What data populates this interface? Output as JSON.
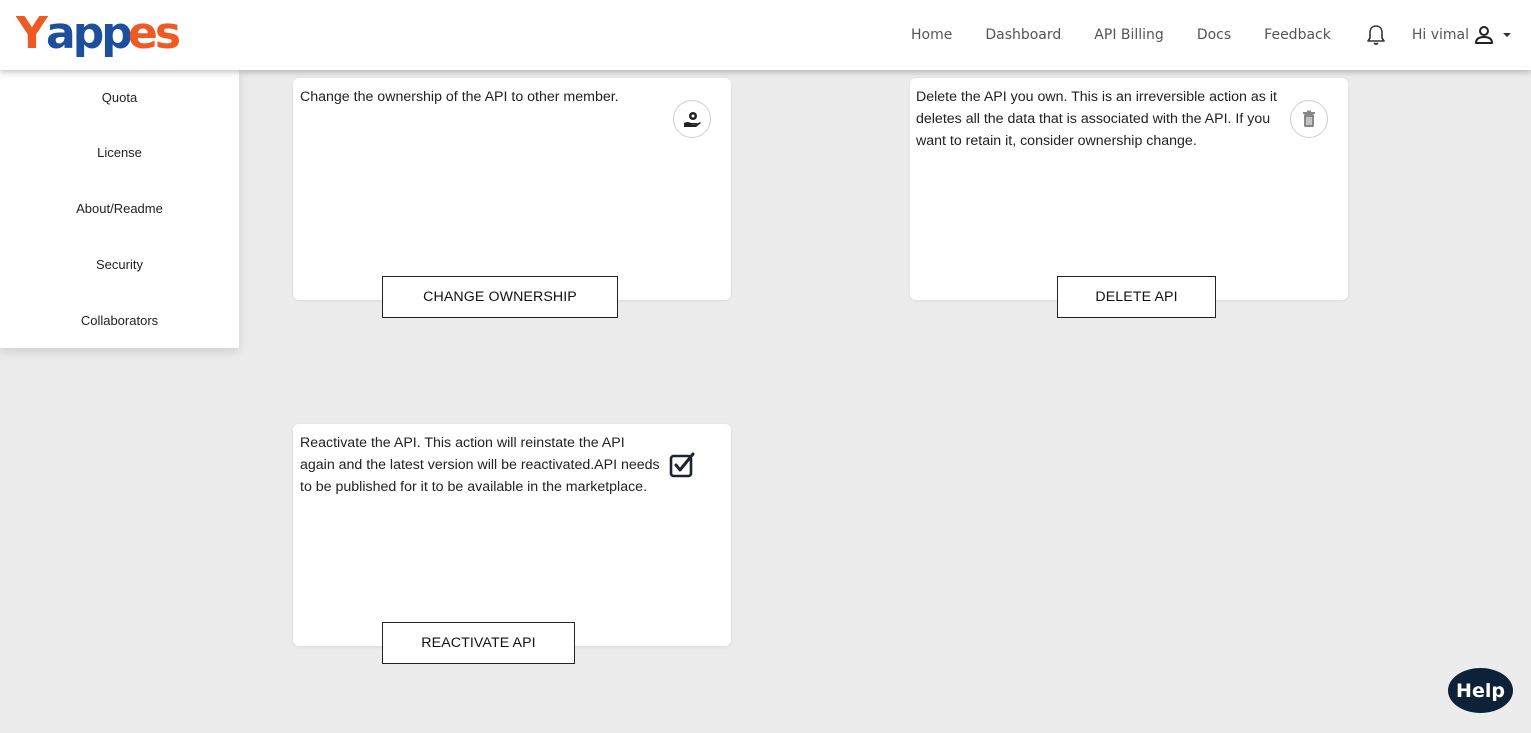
{
  "app": {
    "logo_text": "Yappes"
  },
  "nav": {
    "links": [
      "Home",
      "Dashboard",
      "API Billing",
      "Docs",
      "Feedback"
    ],
    "greeting": "Hi vimal"
  },
  "sidebar": {
    "items": [
      {
        "label": "Quota"
      },
      {
        "label": "License"
      },
      {
        "label": "About/Readme"
      },
      {
        "label": "Security"
      },
      {
        "label": "Collaborators"
      }
    ]
  },
  "cards": {
    "ownership": {
      "description": "Change the ownership of the API to other member.",
      "button": "CHANGE OWNERSHIP",
      "icon": "hand-user-icon"
    },
    "delete": {
      "description": "Delete the API you own. This is an irreversible action as it deletes all the data that is associated with the API. If you want to retain it, consider ownership change.",
      "button": "DELETE API",
      "icon": "trash-icon"
    },
    "reactivate": {
      "description": "Reactivate the API. This action will reinstate the API again and the latest version will be reactivated.API needs to be published for it to be available in the marketplace.",
      "button": "REACTIVATE API",
      "icon": "checkbox-icon"
    }
  },
  "help": {
    "label": "Help"
  },
  "colors": {
    "logo_orange": "#ef5a24",
    "logo_blue": "#1e4f9c",
    "help_bg": "#0d2238",
    "page_bg": "#ececec"
  }
}
